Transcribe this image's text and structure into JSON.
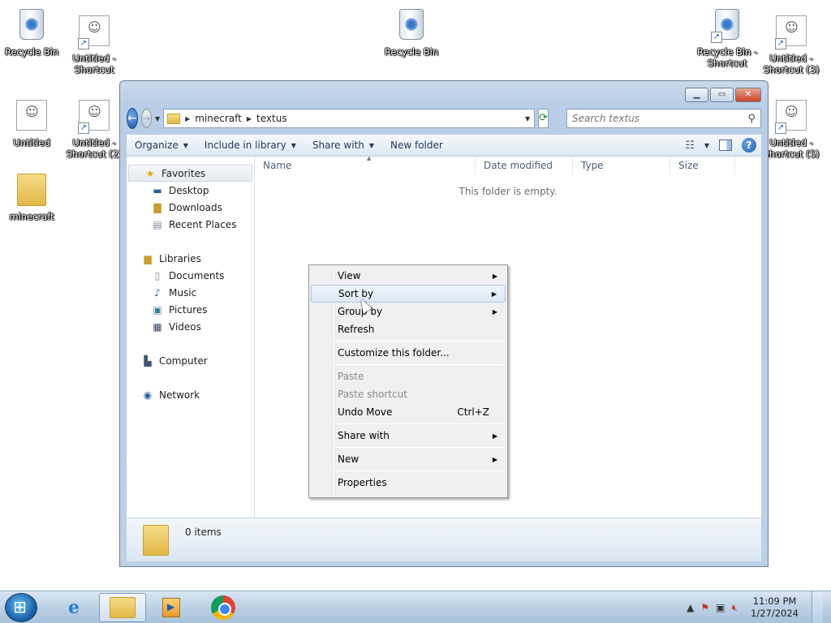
{
  "desktop": {
    "icons": [
      {
        "label": "Recycle Bin"
      },
      {
        "label": "Untitled -\nShortcut"
      },
      {
        "label": "Recycle Bin"
      },
      {
        "label": "Recycle Bin -\nShortcut"
      },
      {
        "label": "Untitled -\nShortcut (3)"
      },
      {
        "label": "Untitled"
      },
      {
        "label": "Untitled -\nShortcut (2)"
      },
      {
        "label": "Untitled -\nShortcut (5)"
      },
      {
        "label": "minecraft"
      }
    ]
  },
  "window": {
    "caption_buttons": {
      "minimize": "▁",
      "maximize": "▭",
      "close": "✕"
    },
    "address": {
      "crumbs": [
        "minecraft",
        "textus"
      ]
    },
    "search": {
      "placeholder": "Search textus"
    },
    "toolbar": {
      "organize": "Organize",
      "include_in_library": "Include in library",
      "share_with": "Share with",
      "new_folder": "New folder"
    },
    "nav": {
      "favorites": "Favorites",
      "desktop": "Desktop",
      "downloads": "Downloads",
      "recent_places": "Recent Places",
      "libraries": "Libraries",
      "documents": "Documents",
      "music": "Music",
      "pictures": "Pictures",
      "videos": "Videos",
      "computer": "Computer",
      "network": "Network"
    },
    "columns": {
      "name": "Name",
      "date_modified": "Date modified",
      "type": "Type",
      "size": "Size"
    },
    "empty_message": "This folder is empty.",
    "details": {
      "item_count": "0 items"
    }
  },
  "context_menu": {
    "view": "View",
    "sort_by": "Sort by",
    "group_by": "Group by",
    "refresh": "Refresh",
    "customize": "Customize this folder...",
    "paste": "Paste",
    "paste_shortcut": "Paste shortcut",
    "undo_move": "Undo Move",
    "undo_shortcut": "Ctrl+Z",
    "share_with": "Share with",
    "new": "New",
    "properties": "Properties"
  },
  "taskbar": {
    "clock_time": "11:09 PM",
    "clock_date": "1/27/2024"
  }
}
